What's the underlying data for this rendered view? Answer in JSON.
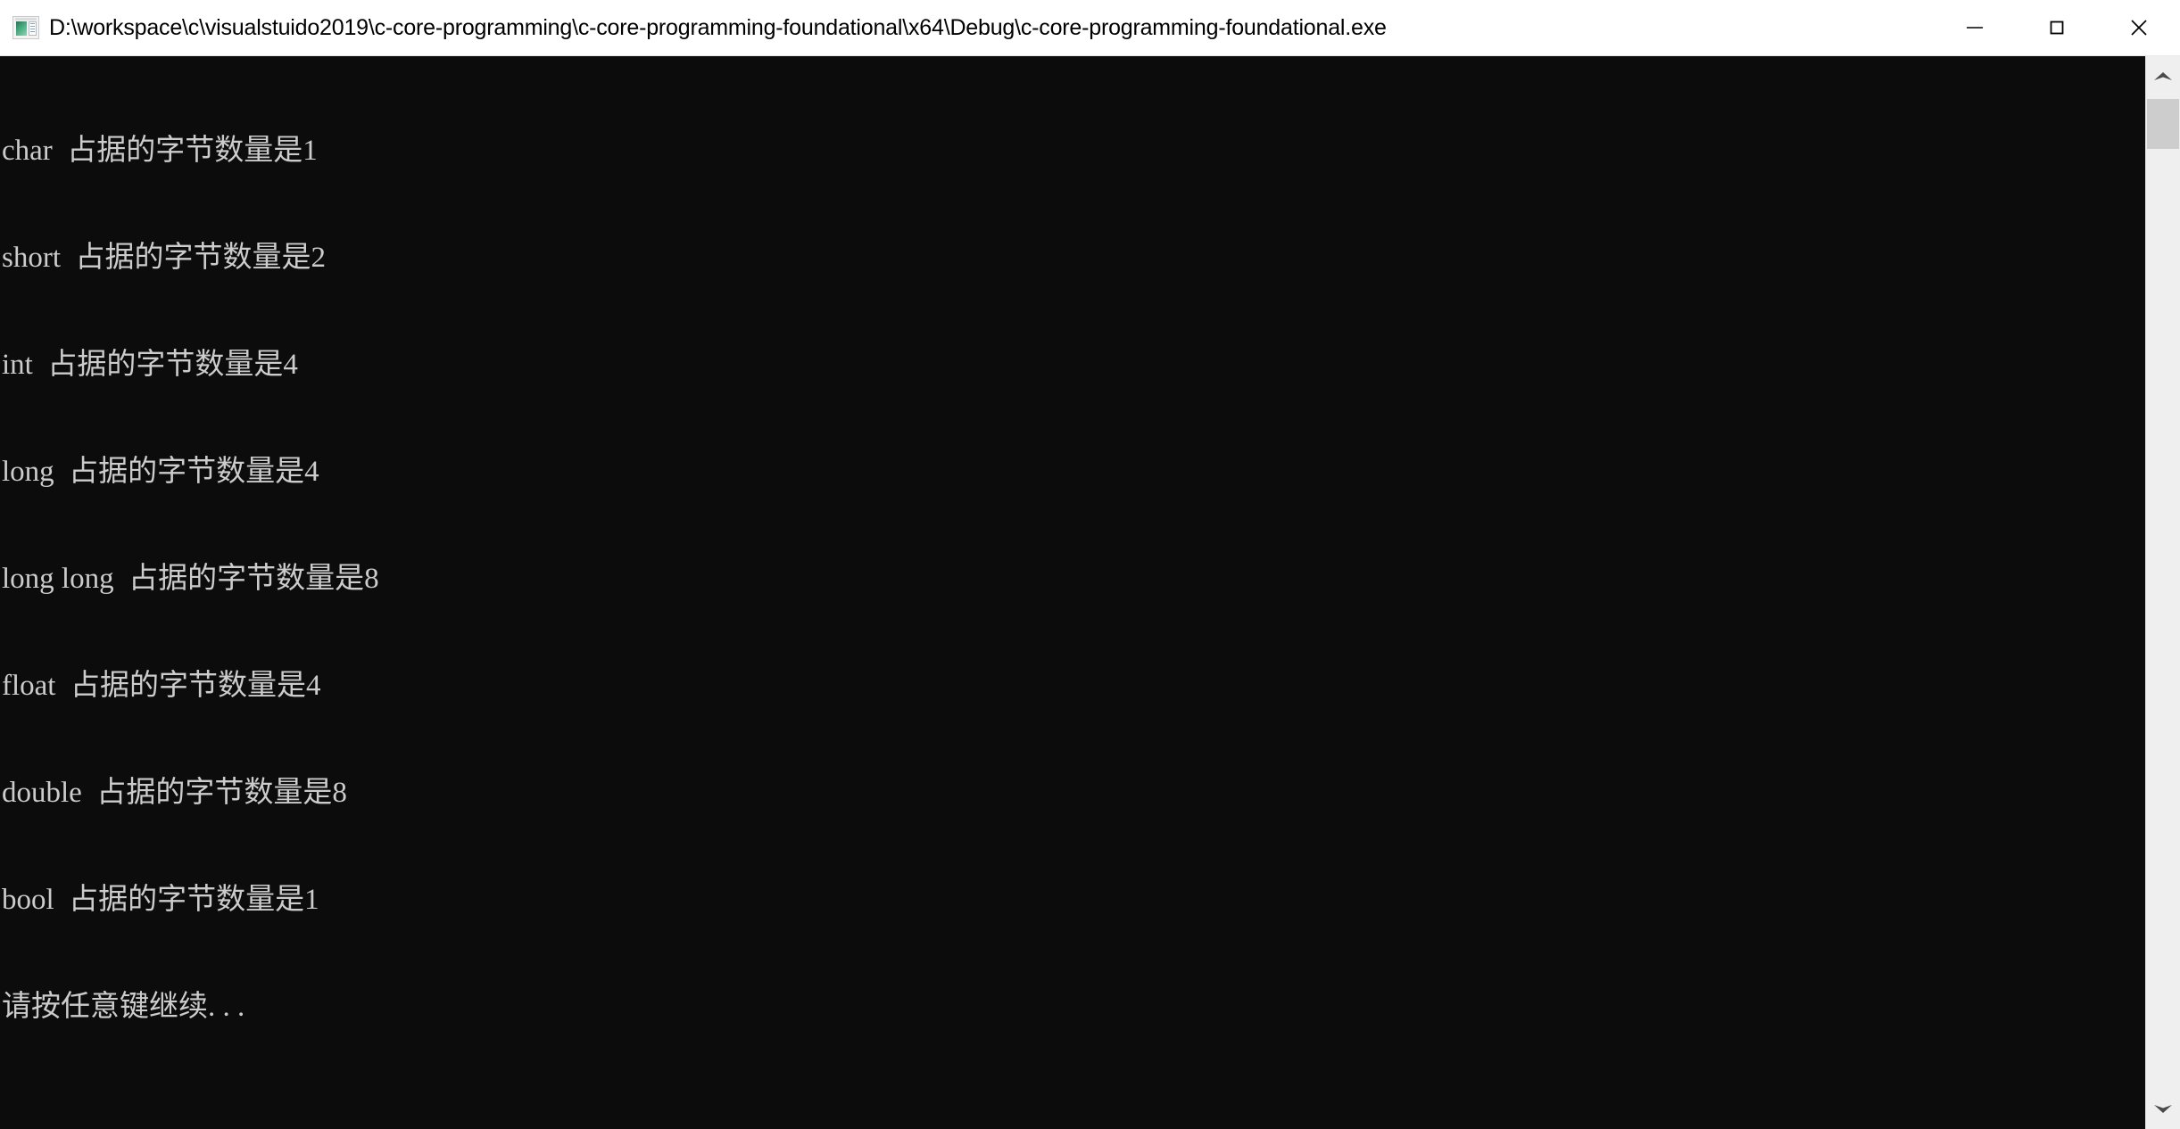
{
  "window": {
    "title": "D:\\workspace\\c\\visualstuido2019\\c-core-programming\\c-core-programming-foundational\\x64\\Debug\\c-core-programming-foundational.exe",
    "icon": "console-app-icon",
    "background_color": "#0c0c0c",
    "text_color": "#cccccc",
    "titlebar_color": "#ffffff",
    "controls": {
      "minimize_label": "Minimize",
      "maximize_label": "Maximize",
      "close_label": "Close"
    }
  },
  "console": {
    "lines": [
      "char  占据的字节数量是1",
      "short  占据的字节数量是2",
      "int  占据的字节数量是4",
      "long  占据的字节数量是4",
      "long long  占据的字节数量是8",
      "float  占据的字节数量是4",
      "double  占据的字节数量是8",
      "bool  占据的字节数量是1",
      "请按任意键继续. . ."
    ]
  },
  "scrollbar": {
    "up_arrow": "chevron-up-icon",
    "down_arrow": "chevron-down-icon",
    "track_color": "#efefef",
    "thumb_color": "#cdcdcd"
  }
}
